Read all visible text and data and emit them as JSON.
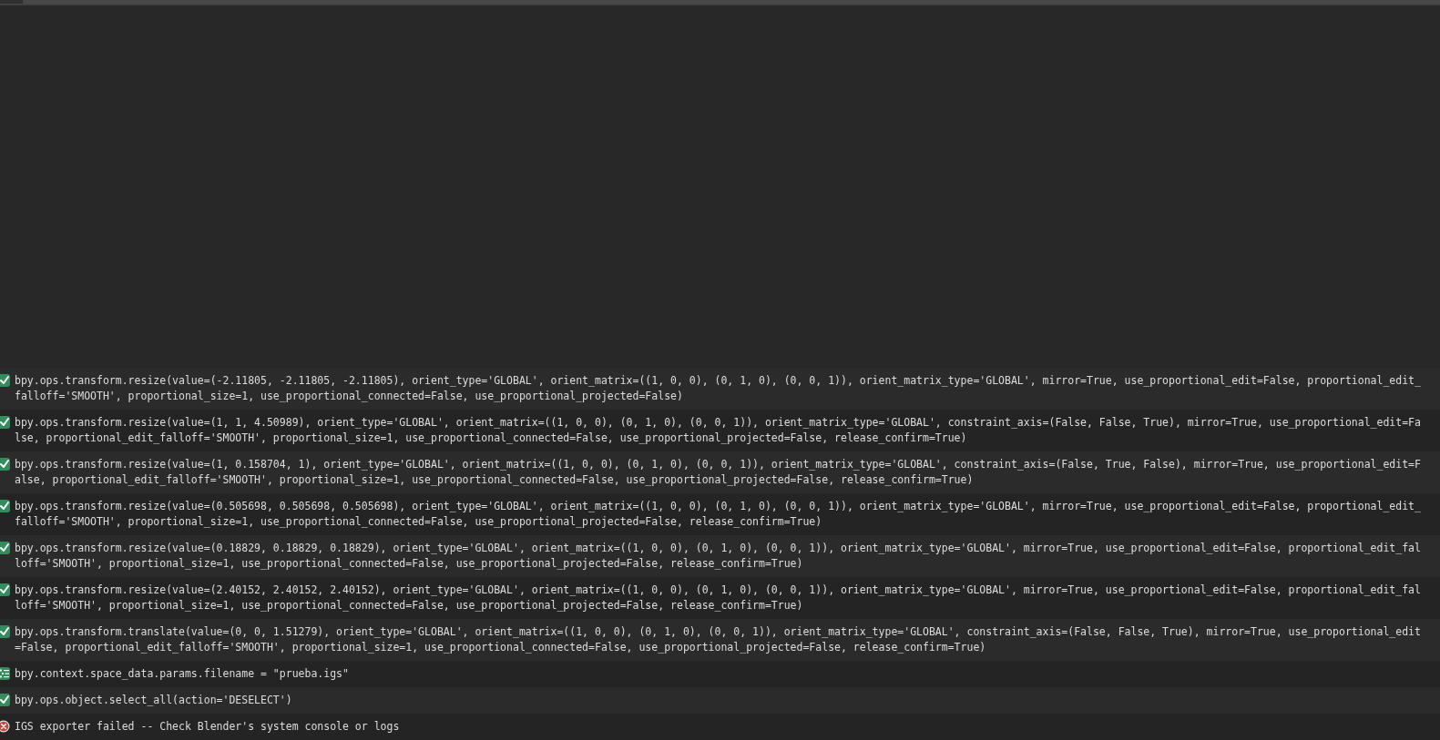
{
  "log": [
    {
      "kind": "operator",
      "lines": [
        "bpy.ops.transform.resize(value=(-2.11805, -2.11805, -2.11805), orient_type='GLOBAL', orient_matrix=((1, 0, 0), (0, 1, 0), (0, 0, 1)), orient_matrix_type='GLOBAL', mirror=True, use_proportional_edit=False, proportional_edit_",
        "falloff='SMOOTH', proportional_size=1, use_proportional_connected=False, use_proportional_projected=False)"
      ]
    },
    {
      "kind": "operator",
      "lines": [
        "bpy.ops.transform.resize(value=(1, 1, 4.50989), orient_type='GLOBAL', orient_matrix=((1, 0, 0), (0, 1, 0), (0, 0, 1)), orient_matrix_type='GLOBAL', constraint_axis=(False, False, True), mirror=True, use_proportional_edit=Fa",
        "lse, proportional_edit_falloff='SMOOTH', proportional_size=1, use_proportional_connected=False, use_proportional_projected=False, release_confirm=True)"
      ]
    },
    {
      "kind": "operator",
      "lines": [
        "bpy.ops.transform.resize(value=(1, 0.158704, 1), orient_type='GLOBAL', orient_matrix=((1, 0, 0), (0, 1, 0), (0, 0, 1)), orient_matrix_type='GLOBAL', constraint_axis=(False, True, False), mirror=True, use_proportional_edit=F",
        "alse, proportional_edit_falloff='SMOOTH', proportional_size=1, use_proportional_connected=False, use_proportional_projected=False, release_confirm=True)"
      ]
    },
    {
      "kind": "operator",
      "lines": [
        "bpy.ops.transform.resize(value=(0.505698, 0.505698, 0.505698), orient_type='GLOBAL', orient_matrix=((1, 0, 0), (0, 1, 0), (0, 0, 1)), orient_matrix_type='GLOBAL', mirror=True, use_proportional_edit=False, proportional_edit_",
        "falloff='SMOOTH', proportional_size=1, use_proportional_connected=False, use_proportional_projected=False, release_confirm=True)"
      ]
    },
    {
      "kind": "operator",
      "lines": [
        "bpy.ops.transform.resize(value=(0.18829, 0.18829, 0.18829), orient_type='GLOBAL', orient_matrix=((1, 0, 0), (0, 1, 0), (0, 0, 1)), orient_matrix_type='GLOBAL', mirror=True, use_proportional_edit=False, proportional_edit_fal",
        "loff='SMOOTH', proportional_size=1, use_proportional_connected=False, use_proportional_projected=False, release_confirm=True)"
      ]
    },
    {
      "kind": "operator",
      "lines": [
        "bpy.ops.transform.resize(value=(2.40152, 2.40152, 2.40152), orient_type='GLOBAL', orient_matrix=((1, 0, 0), (0, 1, 0), (0, 0, 1)), orient_matrix_type='GLOBAL', mirror=True, use_proportional_edit=False, proportional_edit_fal",
        "loff='SMOOTH', proportional_size=1, use_proportional_connected=False, use_proportional_projected=False, release_confirm=True)"
      ]
    },
    {
      "kind": "operator",
      "lines": [
        "bpy.ops.transform.translate(value=(0, 0, 1.51279), orient_type='GLOBAL', orient_matrix=((1, 0, 0), (0, 1, 0), (0, 0, 1)), orient_matrix_type='GLOBAL', constraint_axis=(False, False, True), mirror=True, use_proportional_edit",
        "=False, proportional_edit_falloff='SMOOTH', proportional_size=1, use_proportional_connected=False, use_proportional_projected=False, release_confirm=True)"
      ]
    },
    {
      "kind": "property",
      "lines": [
        "bpy.context.space_data.params.filename = \"prueba.igs\""
      ]
    },
    {
      "kind": "operator",
      "lines": [
        "bpy.ops.object.select_all(action='DESELECT')"
      ]
    },
    {
      "kind": "error",
      "lines": [
        "IGS exporter failed -- Check Blender's system console or logs"
      ]
    }
  ]
}
